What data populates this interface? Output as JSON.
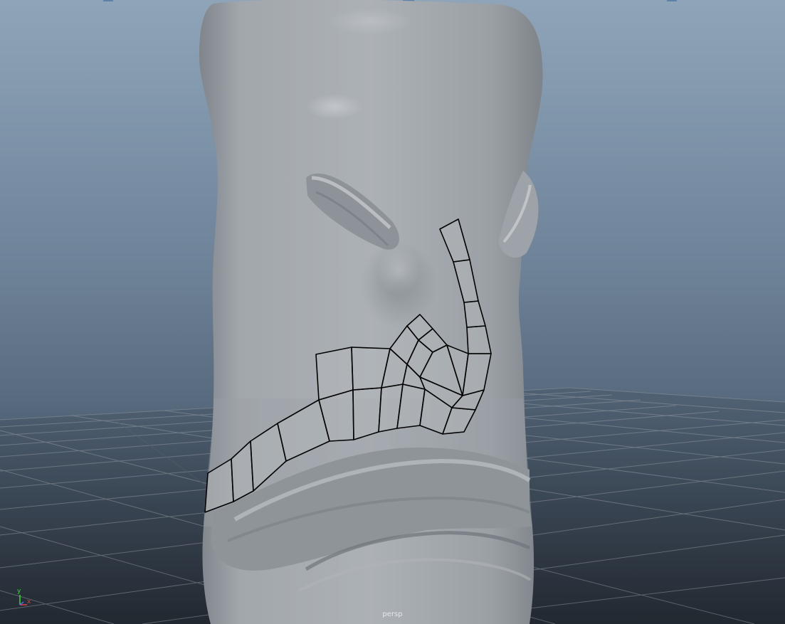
{
  "viewport": {
    "camera_label": "persp",
    "axis": {
      "y_label": "y",
      "x_label": "x"
    },
    "colors": {
      "background_top": "#8fa4b8",
      "background_bottom": "#1f252d",
      "mesh": "#9ea3a8",
      "wireframe": "#000000",
      "grid": "#8a8f96",
      "axis_y": "#44d444",
      "axis_x": "#e04040"
    },
    "objects": {
      "sculpt_icon": "sculpted-mesh",
      "retopo_icon": "retopology-wireframe",
      "grid_icon": "ground-grid"
    }
  }
}
